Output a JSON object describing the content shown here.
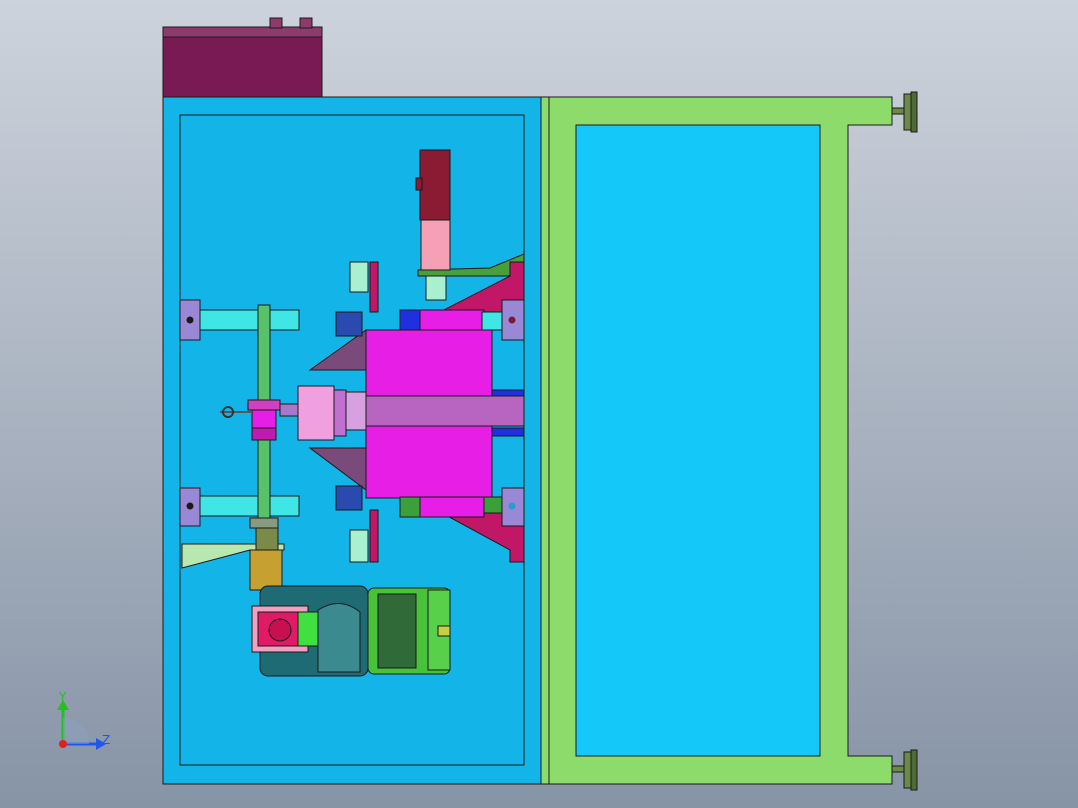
{
  "viewport": {
    "background_top": "#cdd3dc",
    "background_bottom": "#8794a6"
  },
  "colors": {
    "outline": "#1a1a1a",
    "left_frame": "#13b4e8",
    "left_frame_inner": "#e8f6fb",
    "right_frame": "#8ddc6b",
    "right_panel": "#14c8fa",
    "top_box": "#7a1a55",
    "top_box_lid": "#8f3a6d",
    "magenta_block": "#e61ee6",
    "violet_arm": "#b865c2",
    "crimson_plate": "#c21766",
    "dark_red_column": "#8b1a33",
    "pink_sleeve": "#f5a0b4",
    "cyan_bar": "#40e6e6",
    "lavender_bracket": "#9a88d6",
    "green_shaft": "#58c26a",
    "teal_motor": "#1f6b74",
    "green_motor": "#48c23a",
    "olive_block": "#c6a030",
    "mint_block": "#a8f0d0",
    "purple_wedge": "#7a4a7a",
    "blue_bar": "#2030e0",
    "foot_green": "#6b8a48"
  },
  "icons": {
    "triad": "coordinate-triad-icon"
  },
  "axes": {
    "y_label": "Y",
    "z_label": "Z",
    "y_color": "#22c022",
    "z_color": "#2255ee",
    "x_color": "#e02020"
  }
}
